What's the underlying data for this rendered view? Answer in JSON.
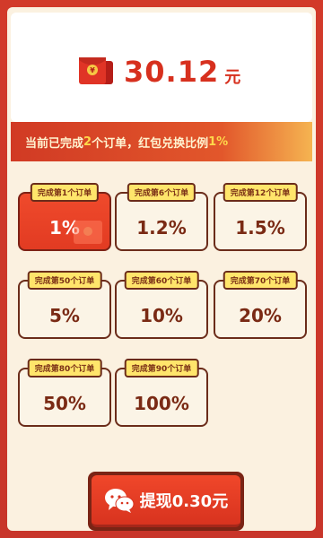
{
  "balance": {
    "amount": "30.12",
    "unit": "元"
  },
  "banner": {
    "prefix": "当前已完成",
    "orders_count": "2",
    "middle": "个订单，红包兑换比例",
    "rate": "1%"
  },
  "tiers": [
    {
      "tag": "完成第1个订单",
      "rate": "1%",
      "active": true
    },
    {
      "tag": "完成第6个订单",
      "rate": "1.2%",
      "active": false
    },
    {
      "tag": "完成第12个订单",
      "rate": "1.5%",
      "active": false
    },
    {
      "tag": "完成第50个订单",
      "rate": "5%",
      "active": false
    },
    {
      "tag": "完成第60个订单",
      "rate": "10%",
      "active": false
    },
    {
      "tag": "完成第70个订单",
      "rate": "20%",
      "active": false
    },
    {
      "tag": "完成第80个订单",
      "rate": "50%",
      "active": false
    },
    {
      "tag": "完成第90个订单",
      "rate": "100%",
      "active": false
    }
  ],
  "withdraw": {
    "label": "提现0.30元",
    "icon": "wechat-icon"
  },
  "colors": {
    "frame": "#d23a2a",
    "accent_red": "#d7301e",
    "highlight_yellow": "#ffd84a",
    "tag_yellow": "#ffe56b"
  }
}
